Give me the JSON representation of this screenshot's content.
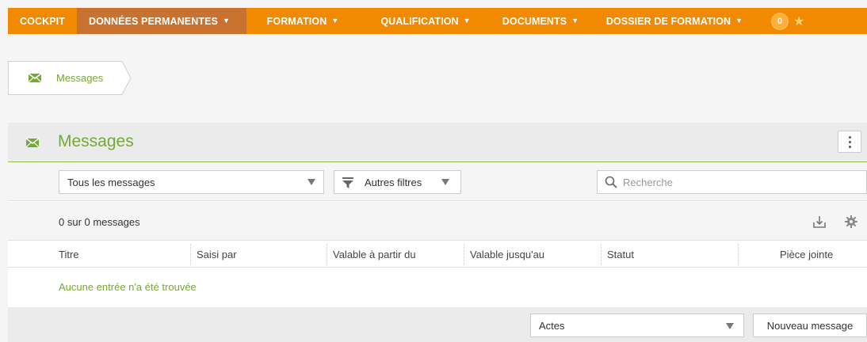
{
  "nav": {
    "items": [
      {
        "label": "COCKPIT"
      },
      {
        "label": "DONNÉES PERMANENTES"
      },
      {
        "label": "FORMATION"
      },
      {
        "label": "QUALIFICATION"
      },
      {
        "label": "DOCUMENTS"
      },
      {
        "label": "DOSSIER DE FORMATION"
      }
    ],
    "caret": "▼",
    "badge": "0",
    "colors": {
      "bar": "#f18a00",
      "active": "#c9722f"
    }
  },
  "breadcrumb": {
    "label": "Messages",
    "icon": "envelope-icon"
  },
  "panel": {
    "title": "Messages",
    "title_color": "#76a835",
    "filter_select": "Tous les messages",
    "autres_filtres": "Autres filtres",
    "search_placeholder": "Recherche",
    "count_text": "0 sur 0 messages",
    "columns": [
      "Titre",
      "Saisi par",
      "Valable à partir du",
      "Valable jusqu'au",
      "Statut",
      "Pièce jointe"
    ],
    "empty_text": "Aucune entrée n'a été trouvée",
    "actions_select": "Actes",
    "new_button": "Nouveau message"
  }
}
